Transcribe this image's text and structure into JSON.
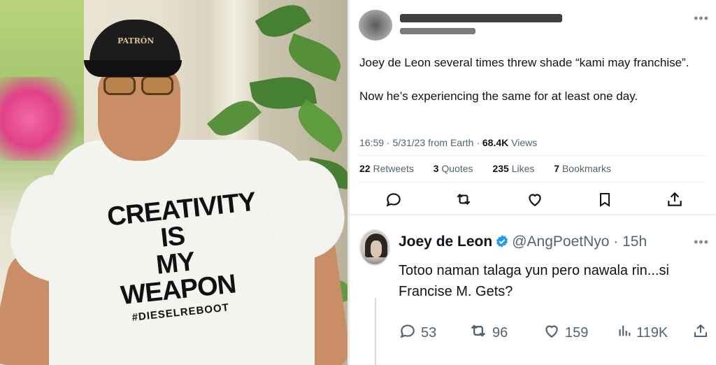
{
  "photo": {
    "cap_mark": "PATRÓN",
    "shirt_lines": [
      "CREATIVITY",
      "IS",
      "MY",
      "WEAPON"
    ],
    "shirt_tag": "#DIESELREBOOT"
  },
  "tweet": {
    "body": [
      "Joey de Leon several times threw shade “kami may franchise”.",
      "Now he’s experiencing the same for at least one day."
    ],
    "timestamp": "16:59 · 5/31/23 from Earth · ",
    "views_count": "68.4K",
    "views_label": " Views",
    "stats": [
      {
        "count": "22",
        "label": "Retweets"
      },
      {
        "count": "3",
        "label": "Quotes"
      },
      {
        "count": "235",
        "label": "Likes"
      },
      {
        "count": "7",
        "label": "Bookmarks"
      }
    ],
    "actions": [
      "reply-icon",
      "retweet-icon",
      "like-icon",
      "bookmark-icon",
      "share-icon"
    ]
  },
  "reply": {
    "name": "Joey de Leon",
    "handle_time": "@AngPoetNyo · 15h",
    "text": "Totoo naman talaga yun pero nawala rin...si Francise M. Gets?",
    "counts": {
      "replies": "53",
      "retweets": "96",
      "likes": "159",
      "views": "119K"
    }
  },
  "colors": {
    "accent": "#1d9bf0",
    "text": "#0f1419",
    "muted": "#536471"
  }
}
